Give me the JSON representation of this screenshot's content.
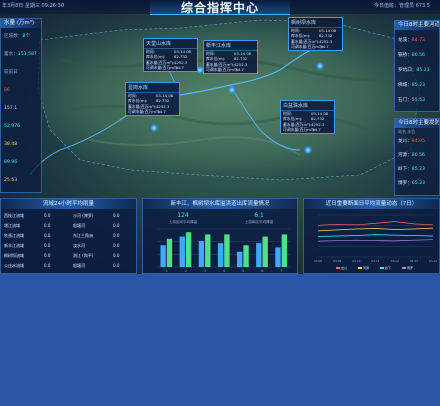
{
  "topbar": {
    "date": "年3月8日 星期三 09:26:30",
    "title": "综合指挥中心",
    "user": "今日值班：管理员 673.5"
  },
  "left_panel": {
    "header": "水量 (万m³)",
    "rows": [
      {
        "label": "区域数",
        "value": "8个",
        "color": "cyan"
      },
      {
        "label": "蓄水",
        "value": "153,587",
        "color": "cyan"
      },
      {
        "label": "",
        "value": "较前日",
        "color": "dim"
      },
      {
        "label": "",
        "value": "86",
        "color": "red"
      },
      {
        "label": "",
        "value": "157.1",
        "color": "yellow"
      },
      {
        "label": "",
        "value": "52,976",
        "color": "cyan"
      },
      {
        "label": "",
        "value": "38.48",
        "color": "yellow"
      },
      {
        "label": "",
        "value": "89.96",
        "color": "cyan"
      },
      {
        "label": "",
        "value": "25.53",
        "color": "yellow"
      }
    ]
  },
  "right_panel_top": {
    "header": "今日8时主要河道",
    "rows": [
      {
        "label": "龙溪",
        "value1": "84.73",
        "value2": "",
        "color": "red"
      },
      {
        "label": "铁桥",
        "value1": "86.56",
        "value2": "",
        "color": "cyan"
      },
      {
        "label": "罗坑口",
        "value1": "85.23",
        "value2": "",
        "color": "cyan"
      },
      {
        "label": "佛城",
        "value1": "85.23",
        "value2": "",
        "color": "cyan"
      },
      {
        "label": "石门",
        "value1": "55.53",
        "value2": "",
        "color": "cyan"
      }
    ]
  },
  "right_panel_bottom": {
    "header": "今日8时主要堤防",
    "sub": "站名 水位",
    "rows": [
      {
        "label": "龙川",
        "value": "84.95",
        "color": "red"
      },
      {
        "label": "河源",
        "value": "86.56",
        "color": "cyan"
      },
      {
        "label": "岭下",
        "value": "85.23",
        "color": "cyan"
      },
      {
        "label": "博罗",
        "value": "65.23",
        "color": "cyan"
      }
    ]
  },
  "popups": [
    {
      "name": "天堂山水库",
      "rows": [
        [
          "时间:",
          "03-14 08"
        ],
        [
          "库水位(m):",
          "82.732"
        ],
        [
          "蓄水量(百万m³):",
          "4252.3"
        ],
        [
          "可调水量(百万m³):",
          "-54.7"
        ]
      ]
    },
    {
      "name": "新丰江水库",
      "rows": [
        [
          "时间:",
          "03-14 08"
        ],
        [
          "库水位(m):",
          "82.732"
        ],
        [
          "蓄水量(百万m³):",
          "4252.3"
        ],
        [
          "可调水量(百万m³):",
          "-54.7"
        ]
      ]
    },
    {
      "name": "枫树坝水库",
      "rows": [
        [
          "时间:",
          "03-14 08"
        ],
        [
          "库水位(m):",
          "82.732"
        ],
        [
          "蓄水量(百万m³):",
          "4252.3"
        ],
        [
          "可调水量(百万m³):",
          "-54.7"
        ]
      ]
    },
    {
      "name": "显岗水库",
      "rows": [
        [
          "时间:",
          "03-14 08"
        ],
        [
          "库水位(m):",
          "82.732"
        ],
        [
          "蓄水量(百万m³):",
          "4252.3"
        ],
        [
          "可调水量(百万m³):",
          "-54.7"
        ]
      ]
    },
    {
      "name": "白盆珠水库",
      "rows": [
        [
          "时间:",
          "03-14 08"
        ],
        [
          "库水位(m):",
          "82.732"
        ],
        [
          "蓄水量(百万m³):",
          "4252.3"
        ],
        [
          "可调水量(百万m³):",
          "-54.7"
        ]
      ]
    }
  ],
  "rain_panel": {
    "header": "流域24小时平均雨量",
    "left": [
      {
        "name": "西枝江流域",
        "value": "0.0"
      },
      {
        "name": "增江流域",
        "value": "0.0"
      },
      {
        "name": "秋香江流域",
        "value": "0.0"
      },
      {
        "name": "新丰江流域",
        "value": "0.0"
      },
      {
        "name": "枫树坝流域",
        "value": "0.0"
      },
      {
        "name": "公庄水流域",
        "value": "0.0"
      }
    ],
    "right": [
      {
        "name": "沙河 (博罗)",
        "value": "0.0"
      },
      {
        "name": "船塘河",
        "value": "0.0"
      },
      {
        "name": "东江三角洲",
        "value": "0.0"
      },
      {
        "name": "淡水河",
        "value": "0.0"
      },
      {
        "name": "浰江 (和平)",
        "value": "0.0"
      },
      {
        "name": "船塘河",
        "value": "0.0"
      }
    ]
  },
  "inflow_panel": {
    "header": "新丰江、枫树坝水库溢洪道出库流量情况",
    "stat1": {
      "value": "124",
      "label": "上游区间平均降量"
    },
    "stat2": {
      "value": "6.1",
      "label": "上游库区平均降量"
    }
  },
  "flow_panel": {
    "header": "近日重要断面日平均流量动态（7日）"
  },
  "chart_data": [
    {
      "type": "bar",
      "categories": [
        "1",
        "2",
        "3",
        "4",
        "5",
        "6",
        "7"
      ],
      "series": [
        {
          "values": [
            20,
            28,
            24,
            22,
            14,
            22,
            18
          ],
          "color": "#3da9ff"
        },
        {
          "values": [
            26,
            32,
            30,
            30,
            20,
            28,
            30
          ],
          "color": "#4fe08a"
        }
      ],
      "ylim": [
        0,
        35
      ]
    },
    {
      "type": "line",
      "categories": [
        "03-08",
        "03-09",
        "03-10",
        "03-11",
        "03-12",
        "03-13",
        "03-14"
      ],
      "series": [
        {
          "name": "龙川",
          "values": [
            680,
            700,
            690,
            720,
            760,
            710,
            690
          ],
          "color": "#ff6a6a"
        },
        {
          "name": "河源",
          "values": [
            560,
            580,
            600,
            610,
            590,
            600,
            620
          ],
          "color": "#ffd54a"
        },
        {
          "name": "岭下",
          "values": [
            440,
            450,
            460,
            480,
            470,
            460,
            450
          ],
          "color": "#38e8ff"
        },
        {
          "name": "博罗",
          "values": [
            340,
            350,
            360,
            350,
            345,
            360,
            370
          ],
          "color": "#c080ff"
        }
      ],
      "ylim": [
        0,
        900
      ]
    }
  ]
}
